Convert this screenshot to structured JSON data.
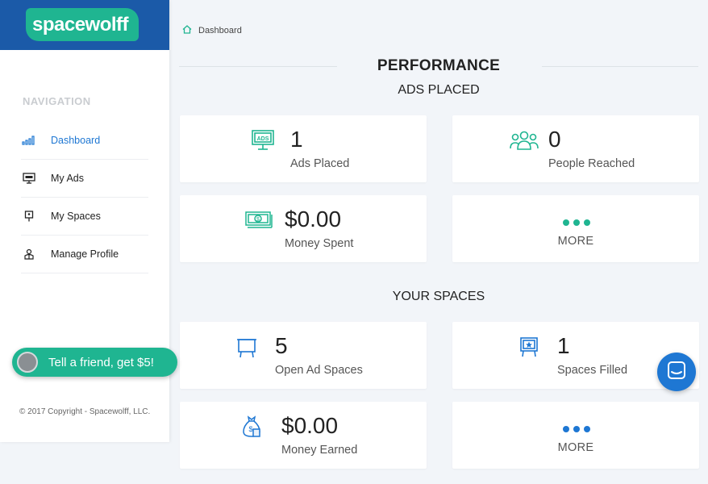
{
  "brand": {
    "logo_text": "spacewolff",
    "primary": "#1b5aa8",
    "accent": "#1fb591",
    "link": "#1e77d3"
  },
  "sidebar": {
    "nav_title": "NAVIGATION",
    "items": [
      {
        "label": "Dashboard",
        "icon": "bar-chart-icon",
        "active": true
      },
      {
        "label": "My Ads",
        "icon": "ads-monitor-icon",
        "active": false
      },
      {
        "label": "My Spaces",
        "icon": "billboard-icon",
        "active": false
      },
      {
        "label": "Manage Profile",
        "icon": "profile-icon",
        "active": false
      }
    ],
    "copyright": "© 2017 Copyright - Spacewolff, LLC."
  },
  "referral": {
    "label": "Tell a friend, get $5!"
  },
  "breadcrumb": {
    "current": "Dashboard"
  },
  "main": {
    "title": "PERFORMANCE",
    "ads_section": {
      "title": "ADS PLACED",
      "cards": [
        {
          "value": "1",
          "label": "Ads Placed",
          "icon": "ads-monitor-icon"
        },
        {
          "value": "0",
          "label": "People Reached",
          "icon": "people-icon"
        },
        {
          "value": "$0.00",
          "label": "Money Spent",
          "icon": "money-bill-icon"
        },
        {
          "label": "MORE",
          "icon": "more-dots-icon"
        }
      ]
    },
    "spaces_section": {
      "title": "YOUR SPACES",
      "cards": [
        {
          "value": "5",
          "label": "Open Ad Spaces",
          "icon": "empty-billboard-icon"
        },
        {
          "value": "1",
          "label": "Spaces Filled",
          "icon": "filled-billboard-icon"
        },
        {
          "value": "$0.00",
          "label": "Money Earned",
          "icon": "money-bag-icon"
        },
        {
          "label": "MORE",
          "icon": "more-dots-icon"
        }
      ]
    }
  }
}
